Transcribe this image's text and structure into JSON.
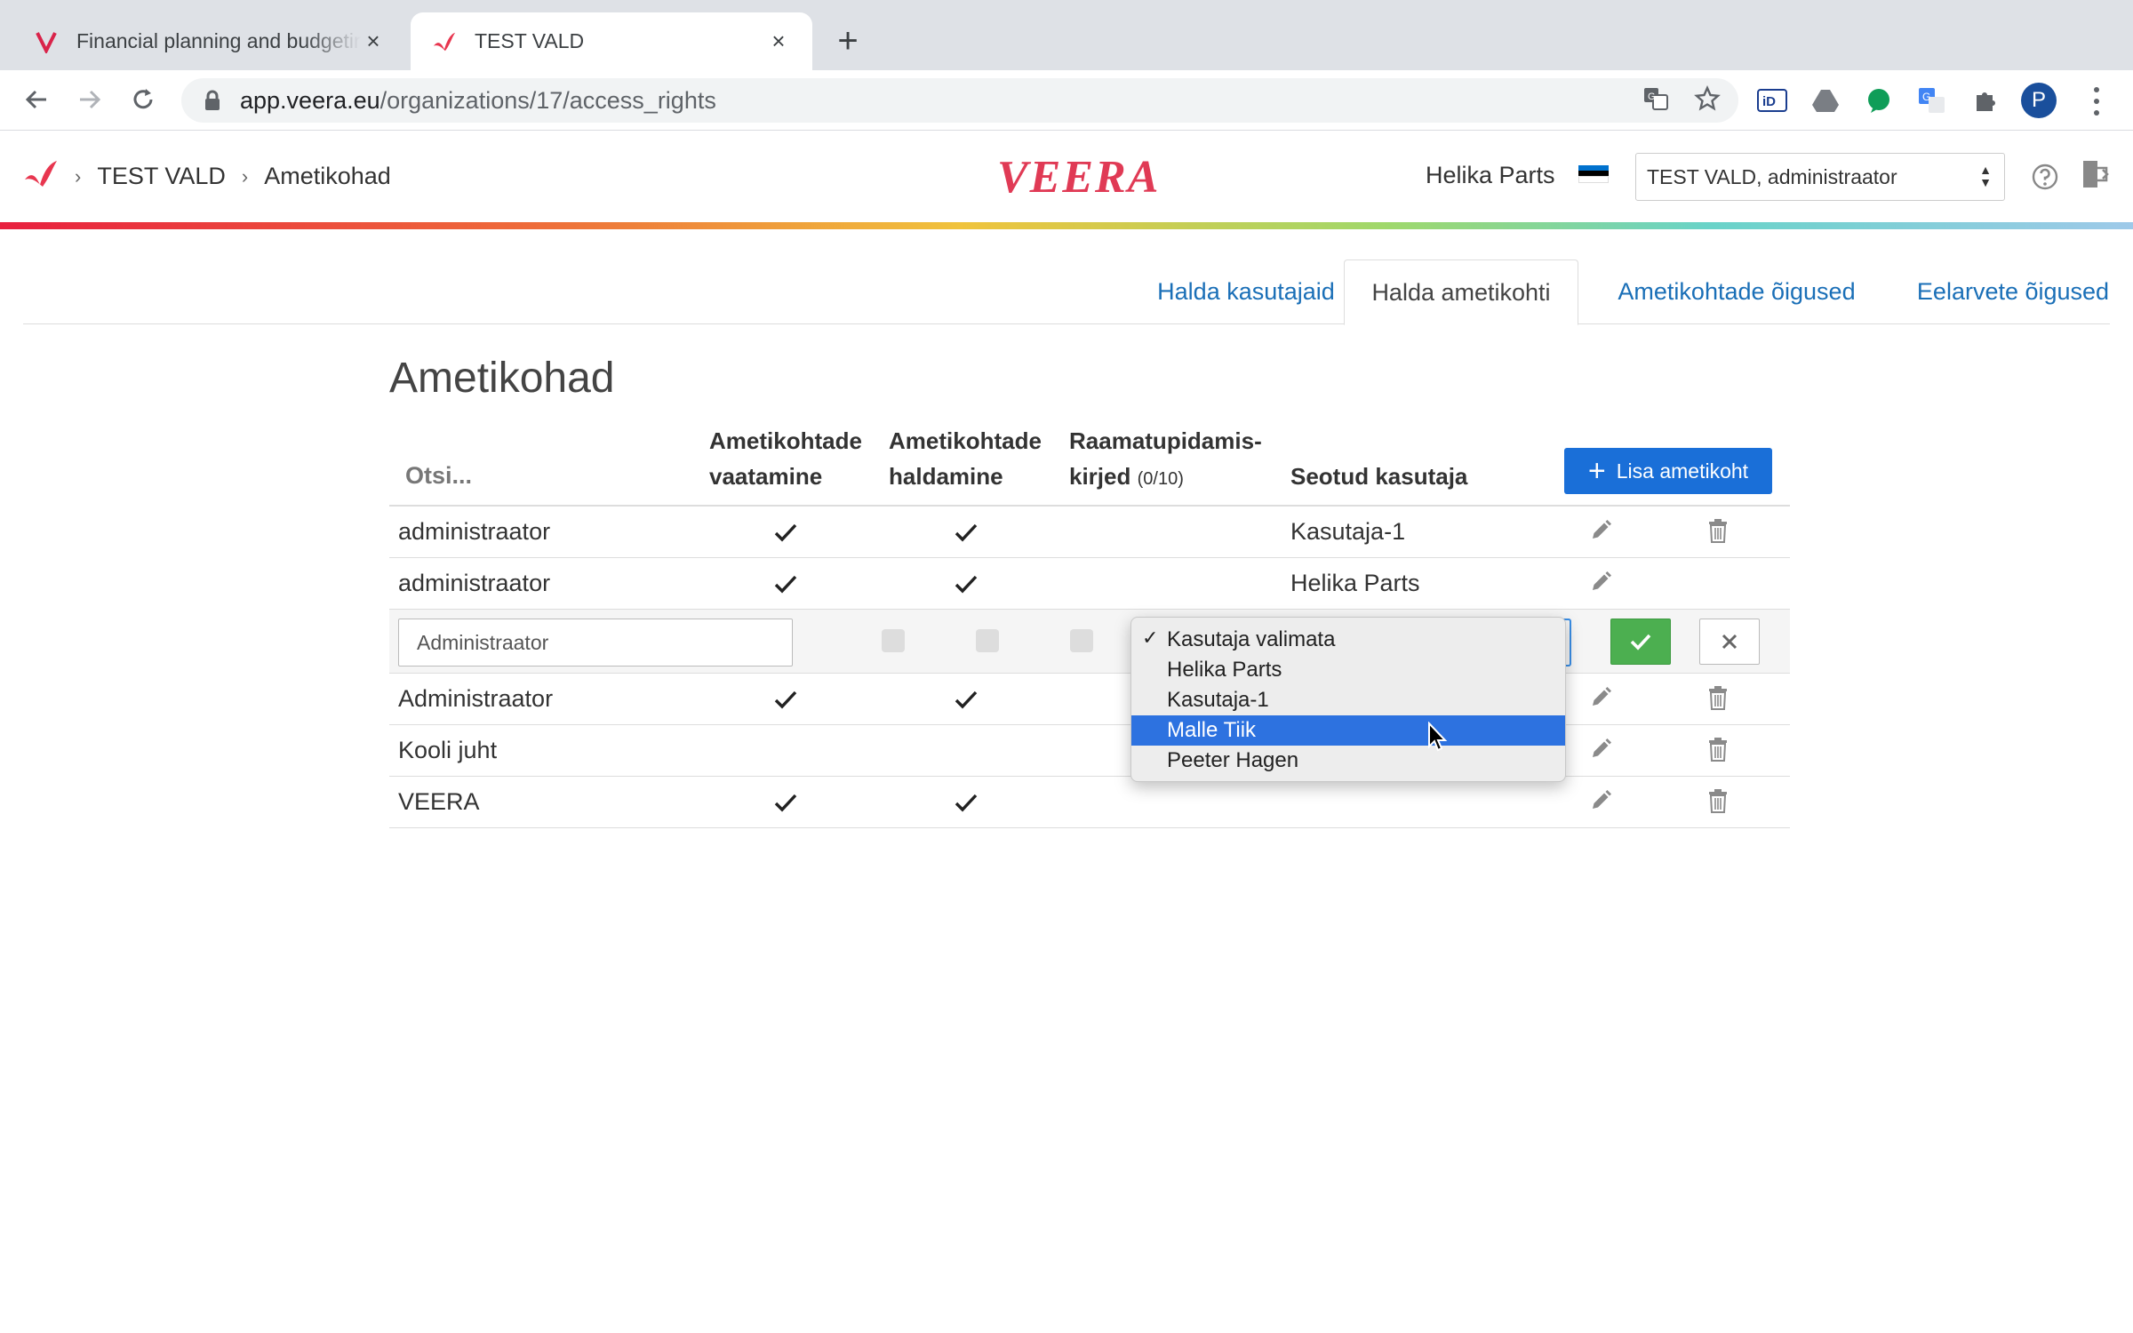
{
  "browser": {
    "tabs": [
      {
        "title": "Financial planning and budgeting"
      },
      {
        "title": "TEST VALD"
      }
    ],
    "url_host": "app.veera.eu",
    "url_path": "/organizations/17/access_rights",
    "profile_initial": "P"
  },
  "header": {
    "breadcrumb": [
      "TEST VALD",
      "Ametikohad"
    ],
    "logo": "VEERA",
    "user_name": "Helika Parts",
    "role_select": "TEST VALD, administraator",
    "flag_colors": [
      "#0072ce",
      "#000000",
      "#ffffff"
    ]
  },
  "tabs": [
    {
      "label": "Halda kasutajaid",
      "active": false
    },
    {
      "label": "Halda ametikohti",
      "active": true
    },
    {
      "label": "Ametikohtade õigused",
      "active": false
    },
    {
      "label": "Eelarvete õigused",
      "active": false
    }
  ],
  "page_title": "Ametikohad",
  "table": {
    "search_placeholder": "Otsi...",
    "columns": {
      "view_1": "Ametikohtade",
      "view_2": "vaatamine",
      "manage_1": "Ametikohtade",
      "manage_2": "haldamine",
      "ledger_1": "Raamatupidamis-",
      "ledger_2": "kirjed",
      "ledger_count": "(0/10)",
      "user": "Seotud kasutaja"
    },
    "add_button": "Lisa ametikoht",
    "rows": [
      {
        "name": "administraator",
        "view": true,
        "manage": true,
        "user": "Kasutaja-1",
        "deletable": true
      },
      {
        "name": "administraator",
        "view": true,
        "manage": true,
        "user": "Helika Parts",
        "deletable": false
      },
      {
        "name": "Administraator",
        "view": true,
        "manage": true,
        "user": "",
        "deletable": true
      },
      {
        "name": "Kooli juht",
        "view": false,
        "manage": false,
        "user": "",
        "deletable": true
      },
      {
        "name": "VEERA",
        "view": true,
        "manage": true,
        "user": "",
        "deletable": true
      }
    ],
    "edit_row": {
      "name_value": "Administraator",
      "insert_after_index": 1
    }
  },
  "dropdown": {
    "options": [
      "Kasutaja valimata",
      "Helika Parts",
      "Kasutaja-1",
      "Malle Tiik",
      "Peeter Hagen"
    ],
    "checked_index": 0,
    "highlighted_index": 3
  },
  "colors": {
    "link": "#1a6fb7",
    "primary_button": "#1a6fd8",
    "confirm_button": "#4caf50",
    "brand": "#e03a55"
  }
}
